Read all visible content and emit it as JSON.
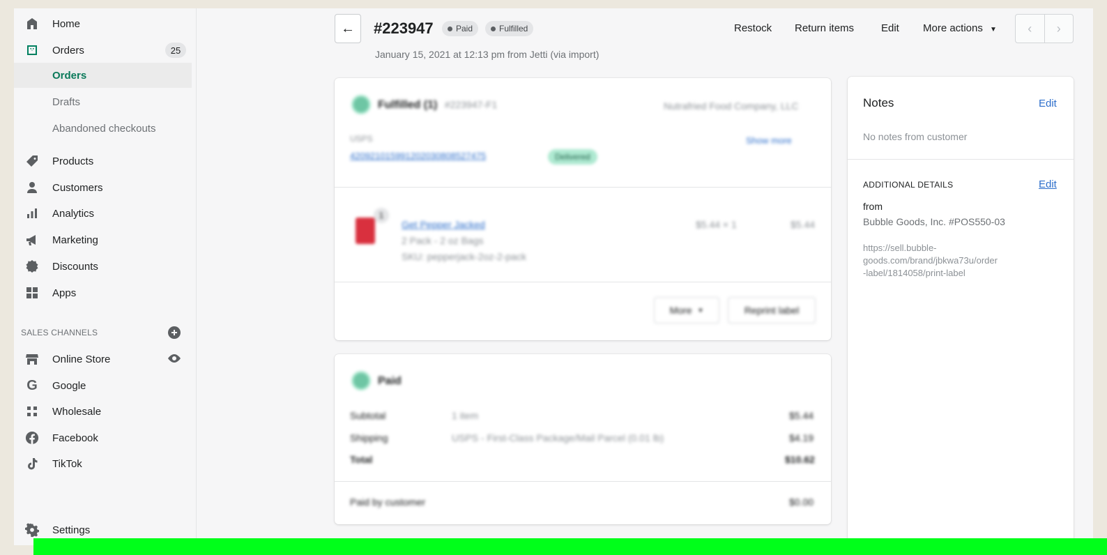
{
  "sidebar": {
    "items": [
      {
        "name": "home",
        "label": "Home",
        "icon": "home-icon"
      },
      {
        "name": "orders",
        "label": "Orders",
        "icon": "orders-icon",
        "badge": "25"
      },
      {
        "name": "products",
        "label": "Products",
        "icon": "tag-icon"
      },
      {
        "name": "customers",
        "label": "Customers",
        "icon": "person-icon"
      },
      {
        "name": "analytics",
        "label": "Analytics",
        "icon": "bar-chart-icon"
      },
      {
        "name": "marketing",
        "label": "Marketing",
        "icon": "megaphone-icon"
      },
      {
        "name": "discounts",
        "label": "Discounts",
        "icon": "discount-icon"
      },
      {
        "name": "apps",
        "label": "Apps",
        "icon": "apps-icon"
      }
    ],
    "orders_sub": [
      "Orders",
      "Drafts",
      "Abandoned checkouts"
    ],
    "sales_channels_label": "SALES CHANNELS",
    "channels": [
      {
        "name": "online-store",
        "label": "Online Store",
        "icon": "store-icon"
      },
      {
        "name": "google",
        "label": "Google",
        "icon": "google-icon"
      },
      {
        "name": "wholesale",
        "label": "Wholesale",
        "icon": "wholesale-icon"
      },
      {
        "name": "facebook",
        "label": "Facebook",
        "icon": "facebook-icon"
      },
      {
        "name": "tiktok",
        "label": "TikTok",
        "icon": "tiktok-icon"
      }
    ],
    "settings_label": "Settings"
  },
  "header": {
    "order_number": "#223947",
    "paid_badge": "Paid",
    "fulfilled_badge": "Fulfilled",
    "subline": "January 15, 2021 at 12:13 pm from Jetti (via import)",
    "actions": [
      "Restock",
      "Return items",
      "Edit",
      "More actions"
    ]
  },
  "fulfilled_card": {
    "title": "Fulfilled (1)",
    "order_ref": "#223947-F1",
    "company": "Nutrafried Food Company, LLC",
    "carrier": "USPS",
    "tracking": "420921015991202030808527475",
    "delivered": "Delivered",
    "show_more": "Show more",
    "product_name": "Get Pepper Jacked",
    "product_variant": "2 Pack - 2 oz Bags",
    "product_sku": "SKU: pepperjack-2oz-2-pack",
    "qty": "1",
    "price_qty": "$5.44 × 1",
    "line_total": "$5.44",
    "more_btn": "More",
    "reprint_btn": "Reprint label"
  },
  "paid_card": {
    "title": "Paid",
    "rows": [
      {
        "label": "Subtotal",
        "desc": "1 item",
        "amount": "$5.44"
      },
      {
        "label": "Shipping",
        "desc": "USPS - First-Class Package/Mail Parcel (0.01 lb)",
        "amount": "$4.19"
      },
      {
        "label": "Total",
        "desc": "",
        "amount": "$10.62"
      }
    ],
    "paid_by_label": "Paid by customer",
    "paid_by_amount": "$0.00"
  },
  "notes_card": {
    "title": "Notes",
    "edit": "Edit",
    "body": "No notes from customer",
    "additional_title": "ADDITIONAL DETAILS",
    "additional_edit": "Edit",
    "from_label": "from",
    "from_value": "Bubble Goods, Inc. #POS550-03",
    "url_line1": "https://sell.bubble-",
    "url_line2": "goods.com/brand/jbkwa73u/order",
    "url_line3": "-label/1814058/print-label"
  }
}
